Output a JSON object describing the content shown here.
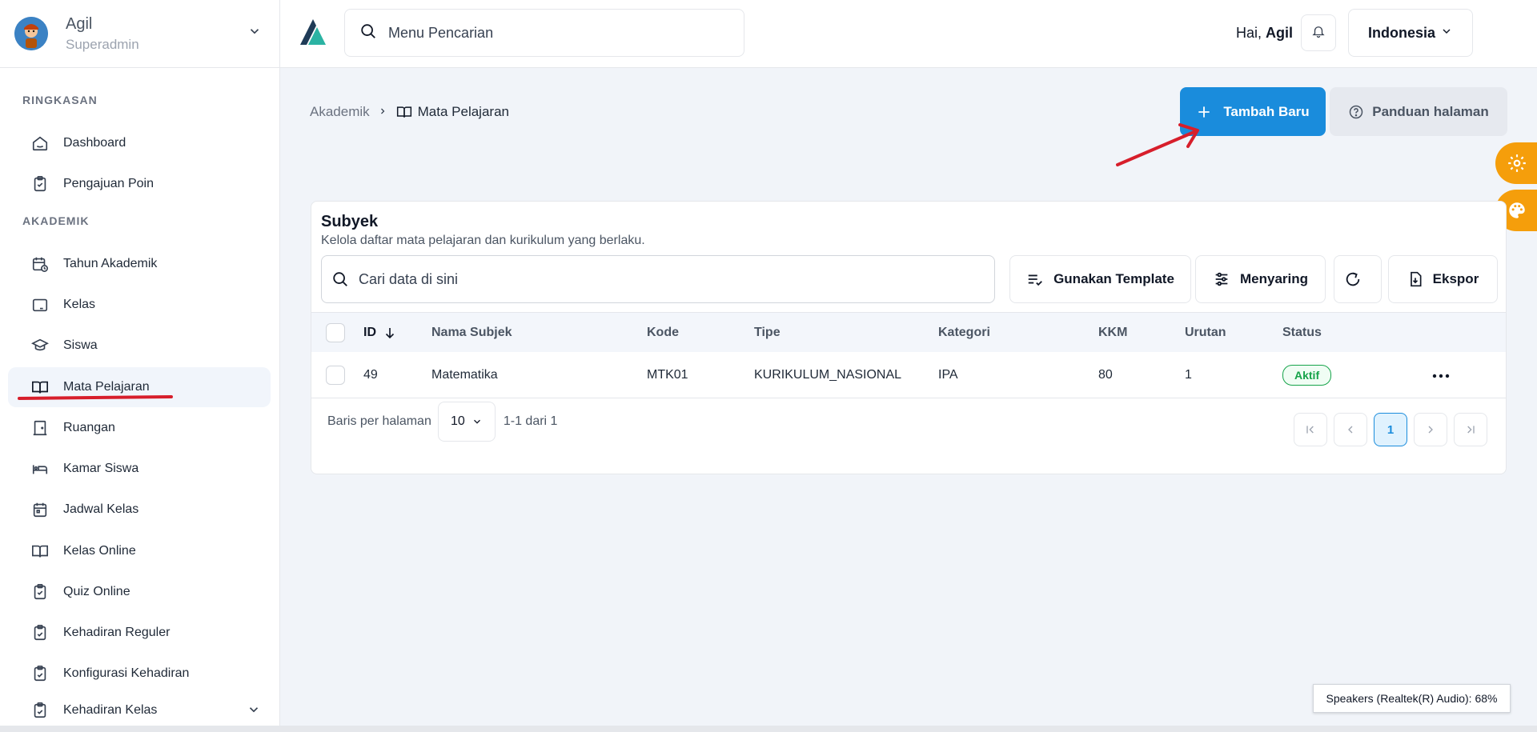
{
  "user": {
    "name": "Agil",
    "role": "Superadmin"
  },
  "sidebar": {
    "sections": [
      {
        "label": "RINGKASAN"
      },
      {
        "label": "AKADEMIK"
      }
    ],
    "items": [
      {
        "label": "Dashboard",
        "icon": "home-icon"
      },
      {
        "label": "Pengajuan Poin",
        "icon": "clipboard-check-icon"
      },
      {
        "label": "Tahun Akademik",
        "icon": "calendar-clock-icon"
      },
      {
        "label": "Kelas",
        "icon": "tablet-icon"
      },
      {
        "label": "Siswa",
        "icon": "graduation-cap-icon"
      },
      {
        "label": "Mata Pelajaran",
        "icon": "book-open-icon",
        "active": true
      },
      {
        "label": "Ruangan",
        "icon": "door-icon"
      },
      {
        "label": "Kamar Siswa",
        "icon": "bed-icon"
      },
      {
        "label": "Jadwal Kelas",
        "icon": "calendar-icon"
      },
      {
        "label": "Kelas Online",
        "icon": "book-open-icon"
      },
      {
        "label": "Quiz Online",
        "icon": "clipboard-check-icon"
      },
      {
        "label": "Kehadiran Reguler",
        "icon": "clipboard-icon"
      },
      {
        "label": "Konfigurasi Kehadiran",
        "icon": "clipboard-icon"
      },
      {
        "label": "Kehadiran Kelas",
        "icon": "clipboard-icon"
      }
    ]
  },
  "topbar": {
    "search_placeholder": "Menu Pencarian",
    "greeting_prefix": "Hai, ",
    "greeting_name": "Agil",
    "language": "Indonesia"
  },
  "breadcrumb": {
    "parent": "Akademik",
    "current": "Mata Pelajaran"
  },
  "actions": {
    "add_new": "Tambah Baru",
    "guide": "Panduan halaman"
  },
  "card": {
    "title": "Subyek",
    "subtitle": "Kelola daftar mata pelajaran dan kurikulum yang berlaku.",
    "search_placeholder": "Cari data di sini",
    "use_template": "Gunakan Template",
    "filter": "Menyaring",
    "export": "Ekspor"
  },
  "table": {
    "columns": [
      "ID",
      "Nama Subjek",
      "Kode",
      "Tipe",
      "Kategori",
      "KKM",
      "Urutan",
      "Status"
    ],
    "rows": [
      {
        "id": "49",
        "name": "Matematika",
        "code": "MTK01",
        "type": "KURIKULUM_NASIONAL",
        "category": "IPA",
        "kkm": "80",
        "order": "1",
        "status": "Aktif"
      }
    ]
  },
  "pagination": {
    "rows_per_page_label": "Baris per halaman",
    "rows_per_page": "10",
    "range": "1-1 dari 1",
    "current_page": "1"
  },
  "toast": "Speakers (Realtek(R) Audio): 68%",
  "colors": {
    "primary": "#1a8cdc",
    "accent_orange": "#f59e0b",
    "active_status": "#16a34a",
    "annotation_red": "#d71e2b"
  }
}
